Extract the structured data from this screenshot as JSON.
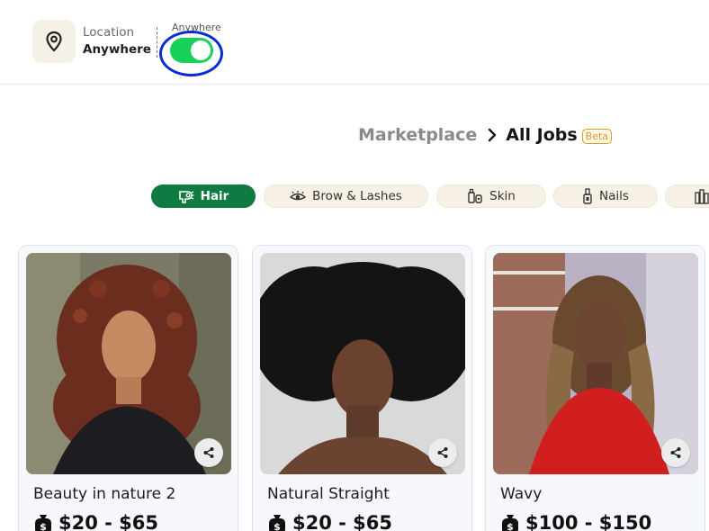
{
  "header": {
    "location_icon": "map-pin-icon",
    "location_label": "Location",
    "location_value": "Anywhere",
    "toggle_caption": "Anywhere",
    "toggle_state": "on",
    "accent_color": "#19d15a",
    "highlight_color": "#0a2bd1"
  },
  "breadcrumb": {
    "parent": "Marketplace",
    "separator_icon": "chevron-right-icon",
    "current": "All Jobs",
    "badge": "Beta"
  },
  "categories": [
    {
      "label": "Hair",
      "icon": "hair-dryer-icon",
      "active": true
    },
    {
      "label": "Brow & Lashes",
      "icon": "eye-icon",
      "active": false
    },
    {
      "label": "Skin",
      "icon": "skincare-bottles-icon",
      "active": false
    },
    {
      "label": "Nails",
      "icon": "nail-polish-icon",
      "active": false
    },
    {
      "label": "",
      "icon": "cosmetics-icon",
      "active": false
    }
  ],
  "brand_color": "#0f7a41",
  "jobs": [
    {
      "title": "Beauty in nature 2",
      "price": "$20 - $65",
      "image": "curly-auburn-hair-photo",
      "share_icon": "share-icon",
      "price_icon": "money-bag-icon"
    },
    {
      "title": "Natural Straight",
      "price": "$20 - $65",
      "image": "natural-afro-hair-photo",
      "share_icon": "share-icon",
      "price_icon": "money-bag-icon"
    },
    {
      "title": "Wavy",
      "price": "$100 - $150",
      "image": "wavy-highlighted-hair-photo",
      "share_icon": "share-icon",
      "price_icon": "money-bag-icon"
    }
  ]
}
